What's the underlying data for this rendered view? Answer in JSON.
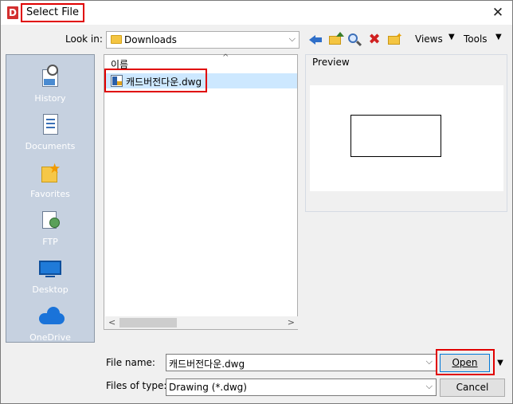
{
  "window": {
    "title": "Select File",
    "app_icon_letter": "D",
    "close_glyph": "✕"
  },
  "toolbar": {
    "look_in_label": "Look in:",
    "look_in_value": "Downloads",
    "views_label": "Views",
    "tools_label": "Tools"
  },
  "places": [
    {
      "label": "History",
      "icon": "history-icon"
    },
    {
      "label": "Documents",
      "icon": "documents-icon"
    },
    {
      "label": "Favorites",
      "icon": "favorites-icon"
    },
    {
      "label": "FTP",
      "icon": "ftp-icon"
    },
    {
      "label": "Desktop",
      "icon": "desktop-icon"
    },
    {
      "label": "OneDrive",
      "icon": "onedrive-icon"
    }
  ],
  "file_list": {
    "column_header": "이름",
    "files": [
      {
        "name": "캐드버전다운.dwg",
        "icon": "dwg-file-icon",
        "selected": true
      }
    ]
  },
  "preview": {
    "label": "Preview"
  },
  "footer": {
    "file_name_label": "File name:",
    "file_name_value": "캐드버전다운.dwg",
    "files_of_type_label": "Files of type:",
    "files_of_type_value": "Drawing (*.dwg)",
    "open_label": "Open",
    "cancel_label": "Cancel"
  },
  "colors": {
    "highlight_box": "#e00000",
    "selection": "#cde8ff",
    "places_panel": "#c6d1e0"
  }
}
